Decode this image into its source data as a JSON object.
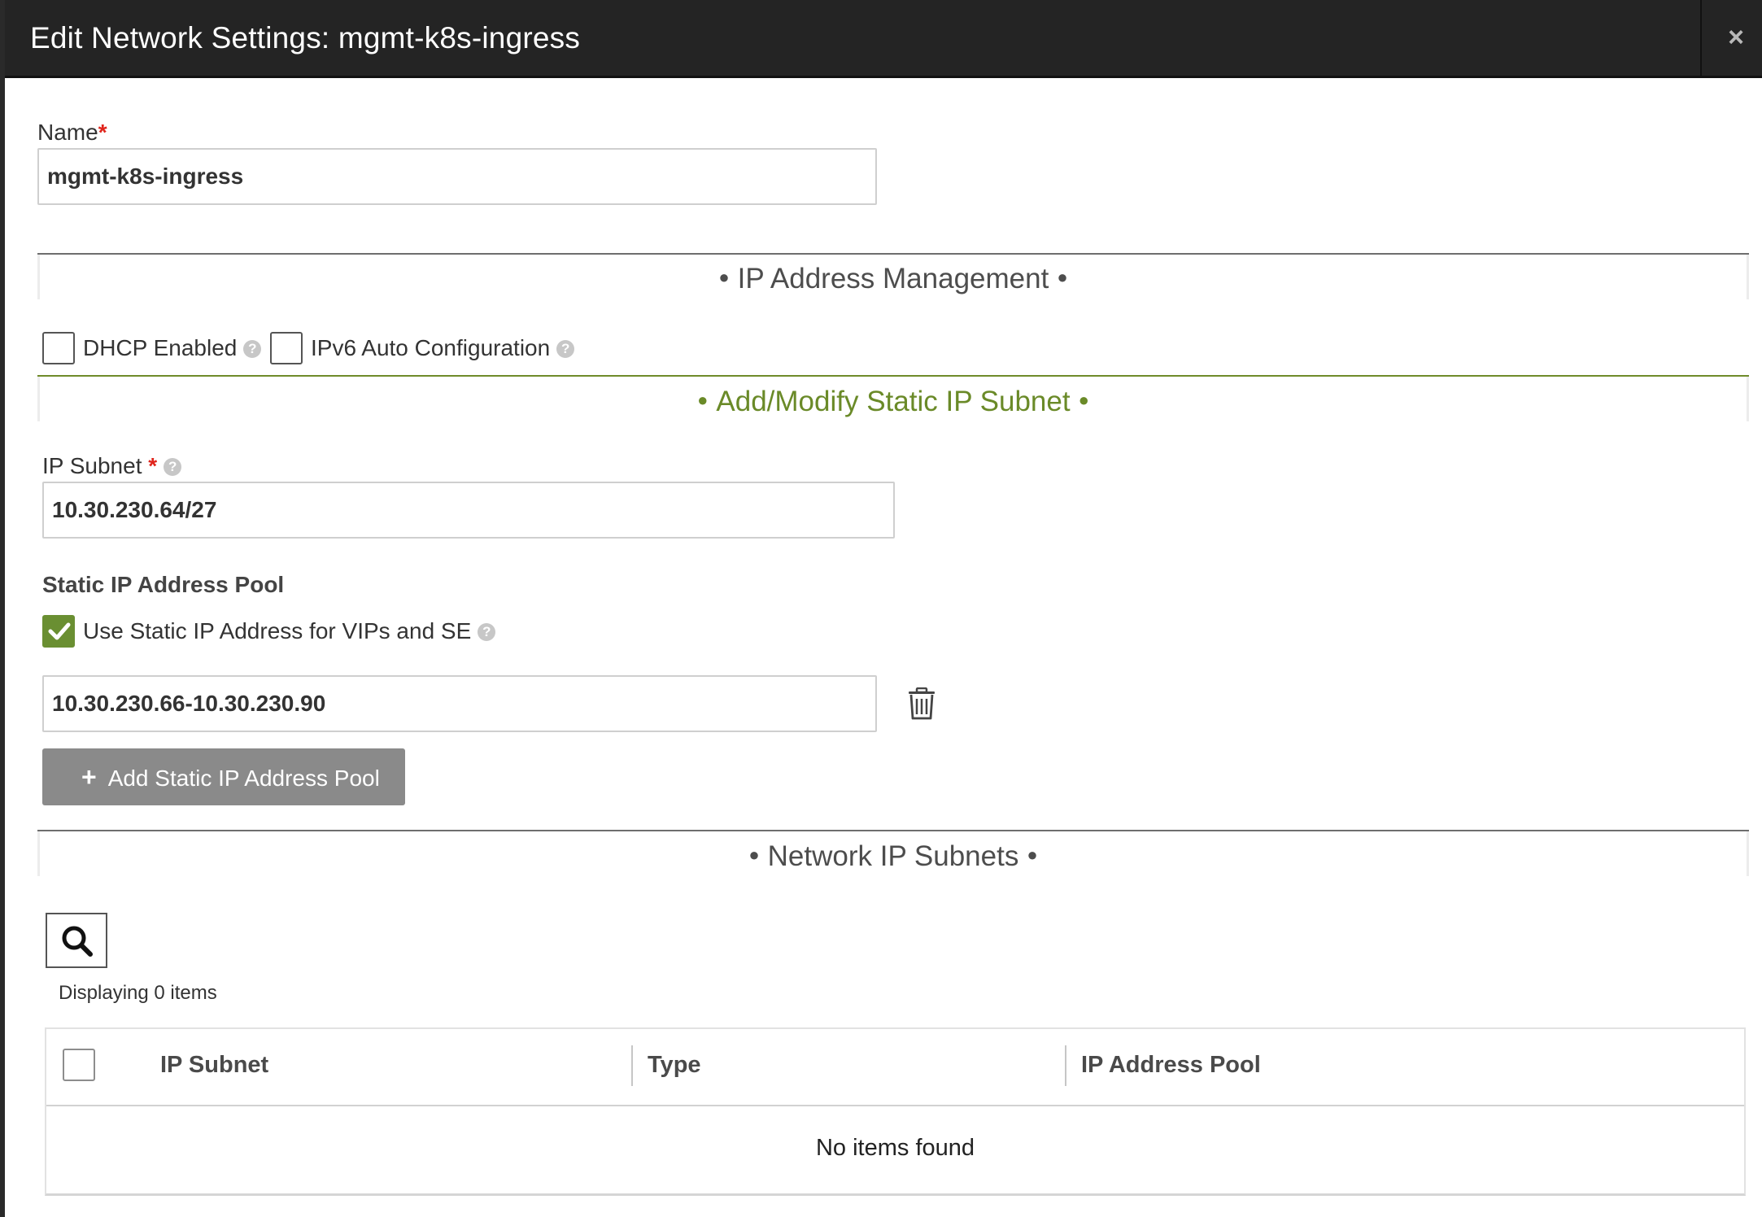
{
  "header": {
    "title": "Edit Network Settings: mgmt-k8s-ingress",
    "close_label": "×"
  },
  "name_field": {
    "label": "Name",
    "required_mark": "*",
    "value": "mgmt-k8s-ingress"
  },
  "ipam_section": {
    "title": "IP Address Management"
  },
  "options": {
    "dhcp": {
      "label": "DHCP Enabled",
      "checked": false
    },
    "ipv6": {
      "label": "IPv6 Auto Configuration",
      "checked": false
    }
  },
  "static_subnet_section": {
    "title": "Add/Modify Static IP Subnet"
  },
  "ip_subnet_field": {
    "label": "IP Subnet",
    "required_mark": "*",
    "value": "10.30.230.64/27"
  },
  "static_pool": {
    "heading": "Static IP Address Pool",
    "use_static": {
      "label": "Use Static IP Address for VIPs and SE",
      "checked": true
    },
    "ranges": [
      "10.30.230.66-10.30.230.90"
    ],
    "add_button": {
      "icon": "+",
      "label": "Add Static IP Address Pool"
    }
  },
  "network_subnets_section": {
    "title": "Network IP Subnets"
  },
  "grid": {
    "count_text": "Displaying 0 items",
    "columns": [
      "IP Subnet",
      "Type",
      "IP Address Pool"
    ],
    "empty_text": "No items found"
  },
  "icons": {
    "help": "question-circle-icon",
    "trash": "trash-icon",
    "search": "search-icon",
    "close": "close-icon"
  },
  "colors": {
    "accent": "#6a8f32",
    "section_green": "#6a8a28",
    "header_bg": "#242424",
    "button_bg": "#8a8a8a",
    "required": "#e0241b"
  }
}
